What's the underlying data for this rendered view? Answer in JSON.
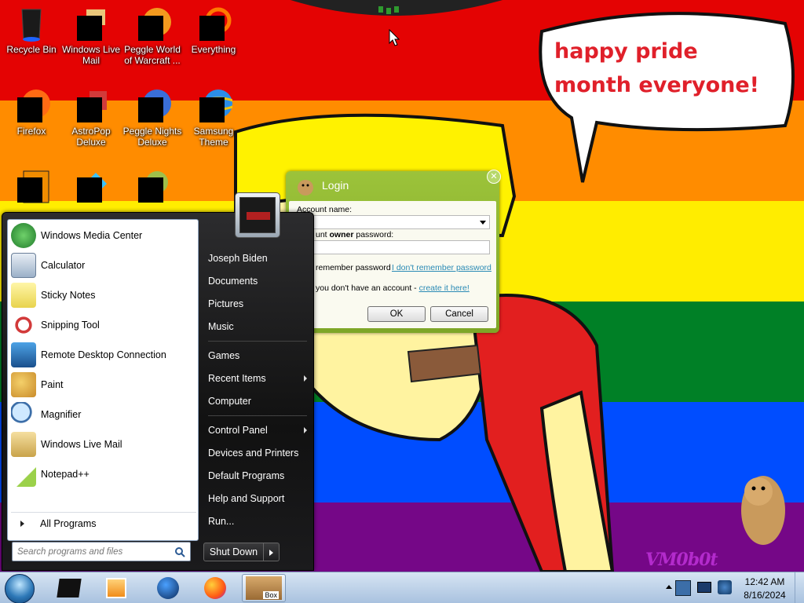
{
  "desktop": {
    "icons": [
      {
        "label": "Recycle Bin",
        "icon": "recycle-bin-icon"
      },
      {
        "label": "Windows Live Mail",
        "icon": "mail-icon"
      },
      {
        "label": "Peggle World of Warcraft ...",
        "icon": "peggle-wow-icon"
      },
      {
        "label": "Everything",
        "icon": "everything-search-icon"
      },
      {
        "label": "Firefox",
        "icon": "firefox-icon"
      },
      {
        "label": "AstroPop Deluxe",
        "icon": "astropop-icon"
      },
      {
        "label": "Peggle Nights Deluxe",
        "icon": "peggle-nights-icon"
      },
      {
        "label": "Samsung Theme",
        "icon": "ie-icon"
      }
    ]
  },
  "wallpaper": {
    "speech_bubble": "happy pride month everyone!",
    "watermark": "VM0b0t"
  },
  "start_menu": {
    "programs": [
      {
        "label": "Windows Media Center",
        "icon": "media-center-icon"
      },
      {
        "label": "Calculator",
        "icon": "calculator-icon"
      },
      {
        "label": "Sticky Notes",
        "icon": "sticky-notes-icon"
      },
      {
        "label": "Snipping Tool",
        "icon": "snipping-tool-icon"
      },
      {
        "label": "Remote Desktop Connection",
        "icon": "remote-desktop-icon"
      },
      {
        "label": "Paint",
        "icon": "paint-icon"
      },
      {
        "label": "Magnifier",
        "icon": "magnifier-icon"
      },
      {
        "label": "Windows Live Mail",
        "icon": "mail-icon"
      },
      {
        "label": "Notepad++",
        "icon": "notepad-icon"
      }
    ],
    "all_programs": "All Programs",
    "search_placeholder": "Search programs and files",
    "right": [
      {
        "label": "Joseph Biden",
        "submenu": false
      },
      {
        "label": "Documents",
        "submenu": false
      },
      {
        "label": "Pictures",
        "submenu": false
      },
      {
        "label": "Music",
        "submenu": false
      },
      {
        "label": "Games",
        "submenu": false
      },
      {
        "label": "Recent Items",
        "submenu": true
      },
      {
        "label": "Computer",
        "submenu": false
      },
      {
        "label": "Control Panel",
        "submenu": true
      },
      {
        "label": "Devices and Printers",
        "submenu": false
      },
      {
        "label": "Default Programs",
        "submenu": false
      },
      {
        "label": "Help and Support",
        "submenu": false
      },
      {
        "label": "Run...",
        "submenu": false
      }
    ],
    "shutdown": "Shut Down"
  },
  "login": {
    "title": "Login",
    "account_label": "Account name:",
    "password_label_start": "unt ",
    "password_label_bold": "owner",
    "password_label_end": " password:",
    "remember": "remember password",
    "forgot_link": "I don't remember password",
    "no_account_text": "you don't have an account - ",
    "create_link": "create it here!",
    "ok": "OK",
    "cancel": "Cancel"
  },
  "taskbar": {
    "time": "12:42 AM",
    "date": "8/16/2024",
    "active_label": "Box"
  },
  "colors": {
    "pride": [
      "#e40303",
      "#ff8c00",
      "#ffed00",
      "#008026",
      "#004dff",
      "#750787"
    ],
    "login_green": "#8bb52f",
    "link_blue": "#2a8ab5"
  }
}
